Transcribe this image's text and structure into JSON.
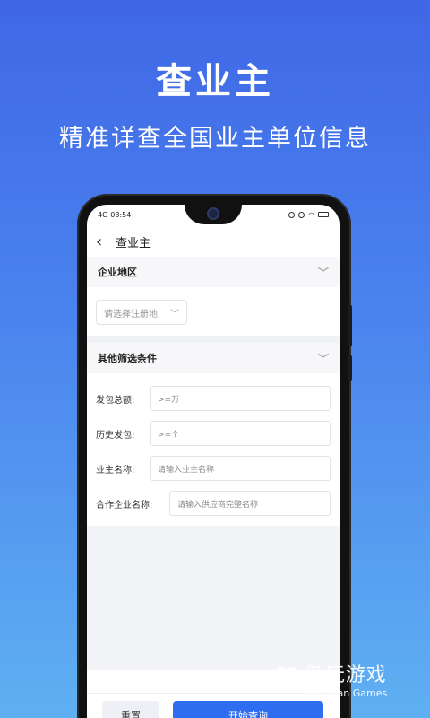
{
  "hero": {
    "title": "查业主",
    "subtitle": "精准详查全国业主单位信息"
  },
  "status_bar": {
    "signal": "4G",
    "time": "08:54"
  },
  "nav": {
    "back_icon": "chevron-left",
    "title": "查业主"
  },
  "region_section": {
    "title": "企业地区",
    "select_placeholder": "请选择注册地"
  },
  "filter_section": {
    "title": "其他筛选条件",
    "fields": [
      {
        "label": "发包总额:",
        "placeholder": ">=万"
      },
      {
        "label": "历史发包:",
        "placeholder": ">=个"
      },
      {
        "label": "业主名称:",
        "placeholder": "请输入业主名称"
      },
      {
        "label": "合作企业名称:",
        "placeholder": "请输入供应商完整名称"
      }
    ]
  },
  "actions": {
    "reset": "重置",
    "query": "开始查询"
  },
  "watermark": {
    "cn": "仍玩游戏",
    "en": "Rengwan Games"
  },
  "colors": {
    "primary": "#2f6df0",
    "bg_top": "#3f67e6",
    "bg_bottom": "#5fb0f2"
  }
}
